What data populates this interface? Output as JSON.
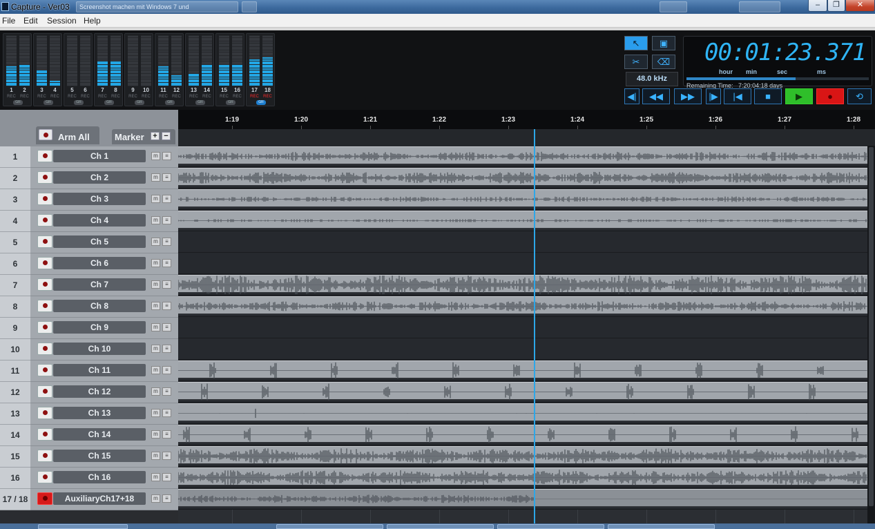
{
  "window": {
    "title": "Capture - Ver03",
    "background_tabs": [
      "Screenshot machen mit Windows 7 und",
      "",
      "",
      "",
      ""
    ]
  },
  "menu": [
    "File",
    "Edit",
    "Session",
    "Help"
  ],
  "meters": [
    {
      "num": "1",
      "level": 0.4,
      "rec": "REC",
      "armed": false
    },
    {
      "num": "2",
      "level": 0.44,
      "rec": "REC",
      "armed": false
    },
    {
      "num": "3",
      "level": 0.32,
      "rec": "REC",
      "armed": false
    },
    {
      "num": "4",
      "level": 0.12,
      "rec": "REC",
      "armed": false
    },
    {
      "num": "5",
      "level": 0.0,
      "rec": "REC",
      "armed": false
    },
    {
      "num": "6",
      "level": 0.0,
      "rec": "REC",
      "armed": false
    },
    {
      "num": "7",
      "level": 0.5,
      "rec": "REC",
      "armed": false
    },
    {
      "num": "8",
      "level": 0.5,
      "rec": "REC",
      "armed": false
    },
    {
      "num": "9",
      "level": 0.0,
      "rec": "REC",
      "armed": false
    },
    {
      "num": "10",
      "level": 0.0,
      "rec": "REC",
      "armed": false
    },
    {
      "num": "11",
      "level": 0.4,
      "rec": "REC",
      "armed": false
    },
    {
      "num": "12",
      "level": 0.2,
      "rec": "REC",
      "armed": false
    },
    {
      "num": "13",
      "level": 0.24,
      "rec": "REC",
      "armed": false
    },
    {
      "num": "14",
      "level": 0.44,
      "rec": "REC",
      "armed": false
    },
    {
      "num": "15",
      "level": 0.44,
      "rec": "REC",
      "armed": false
    },
    {
      "num": "16",
      "level": 0.44,
      "rec": "REC",
      "armed": false
    },
    {
      "num": "17",
      "level": 0.54,
      "rec": "REC",
      "armed": true
    },
    {
      "num": "18",
      "level": 0.56,
      "rec": "REC",
      "armed": true
    }
  ],
  "link_buttons": [
    {
      "label": "GR",
      "active": false
    },
    {
      "label": "GR",
      "active": false
    },
    {
      "label": "GR",
      "active": false
    },
    {
      "label": "GR",
      "active": false
    },
    {
      "label": "GR",
      "active": false
    },
    {
      "label": "GR",
      "active": false
    },
    {
      "label": "GR",
      "active": false
    },
    {
      "label": "GR",
      "active": false
    },
    {
      "label": "GR",
      "active": true
    }
  ],
  "tools": {
    "pointer": "↖",
    "range": "▣",
    "cut": "✂",
    "erase": "⌫"
  },
  "sample_rate": "48.0 kHz",
  "clock": {
    "time": "00:01:23.371",
    "units": [
      "hour",
      "min",
      "sec",
      "ms"
    ],
    "remaining_label": "Remaining Time:",
    "remaining_value": "7:20:04:18 days",
    "position_fraction": 0.6
  },
  "transport": {
    "prev": "◀|",
    "rewind": "◀◀",
    "forward": "▶▶",
    "next": "|▶",
    "return_to_start": "|◀",
    "stop": "■",
    "play": "▶",
    "record": "●",
    "loop": "⟲"
  },
  "track_header": {
    "arm_all": "Arm All",
    "marker": "Marker",
    "marker_add": "+",
    "marker_remove": "−"
  },
  "tracks": [
    {
      "num": "1",
      "name": "Ch 1",
      "armed": false,
      "clip": true,
      "density": 0.35,
      "burst": false
    },
    {
      "num": "2",
      "name": "Ch 2",
      "armed": false,
      "clip": true,
      "density": 0.5,
      "burst": false
    },
    {
      "num": "3",
      "name": "Ch 3",
      "armed": false,
      "clip": true,
      "density": 0.15,
      "burst": false
    },
    {
      "num": "4",
      "name": "Ch 4",
      "armed": false,
      "clip": true,
      "density": 0.0,
      "burst": false
    },
    {
      "num": "5",
      "name": "Ch 5",
      "armed": false,
      "clip": false,
      "density": 0.0,
      "burst": false
    },
    {
      "num": "6",
      "name": "Ch 6",
      "armed": false,
      "clip": false,
      "density": 0.0,
      "burst": false
    },
    {
      "num": "7",
      "name": "Ch 7",
      "armed": false,
      "clip": true,
      "density": 0.95,
      "burst": false
    },
    {
      "num": "8",
      "name": "Ch 8",
      "armed": false,
      "clip": true,
      "density": 0.4,
      "burst": false
    },
    {
      "num": "9",
      "name": "Ch 9",
      "armed": false,
      "clip": false,
      "density": 0.0,
      "burst": false
    },
    {
      "num": "10",
      "name": "Ch 10",
      "armed": false,
      "clip": false,
      "density": 0.0,
      "burst": false
    },
    {
      "num": "11",
      "name": "Ch 11",
      "armed": false,
      "clip": true,
      "density": 0.6,
      "burst": true
    },
    {
      "num": "12",
      "name": "Ch 12",
      "armed": false,
      "clip": true,
      "density": 0.25,
      "burst": true
    },
    {
      "num": "13",
      "name": "Ch 13",
      "armed": false,
      "clip": true,
      "density": 0.08,
      "burst": true
    },
    {
      "num": "14",
      "name": "Ch 14",
      "armed": false,
      "clip": true,
      "density": 0.5,
      "burst": true
    },
    {
      "num": "15",
      "name": "Ch 15",
      "armed": false,
      "clip": true,
      "density": 0.7,
      "burst": false
    },
    {
      "num": "16",
      "name": "Ch 16",
      "armed": false,
      "clip": true,
      "density": 0.7,
      "burst": false
    },
    {
      "num": "17 / 18",
      "name": "AuxiliaryCh17+18",
      "armed": true,
      "clip": true,
      "density": 0.3,
      "burst": false,
      "aux": true
    }
  ],
  "ruler": {
    "ticks": [
      "1:19",
      "1:20",
      "1:21",
      "1:22",
      "1:23",
      "1:24",
      "1:25",
      "1:26",
      "1:27",
      "1:28"
    ]
  },
  "colors": {
    "accent": "#2da7e8",
    "meter": "#23a7e6",
    "record": "#d91515",
    "play": "#2fbf2a",
    "waveform": "#4a4f56"
  }
}
